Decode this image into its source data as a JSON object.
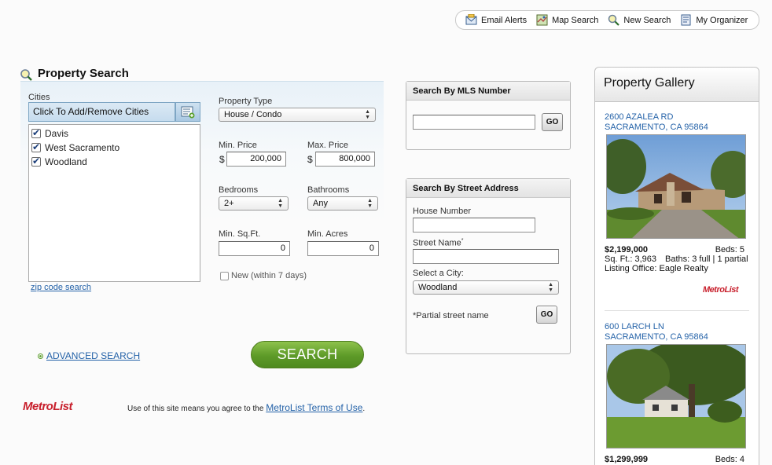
{
  "topnav": {
    "items": [
      {
        "label": "Email Alerts",
        "icon": "email-alerts-icon"
      },
      {
        "label": "Map Search",
        "icon": "map-icon"
      },
      {
        "label": "New Search",
        "icon": "search-icon"
      },
      {
        "label": "My Organizer",
        "icon": "organizer-icon"
      }
    ]
  },
  "property_search": {
    "title": "Property Search",
    "cities_label": "Cities",
    "cities_button": "Click To Add/Remove Cities",
    "cities": [
      {
        "name": "Davis",
        "checked": true
      },
      {
        "name": "West Sacramento",
        "checked": true
      },
      {
        "name": "Woodland",
        "checked": true
      }
    ],
    "zip_link": "zip code search",
    "property_type_label": "Property Type",
    "property_type_value": "House / Condo",
    "min_price_label": "Min. Price",
    "min_price_value": "200,000",
    "max_price_label": "Max. Price",
    "max_price_value": "800,000",
    "currency": "$",
    "bedrooms_label": "Bedrooms",
    "bedrooms_value": "2+",
    "bathrooms_label": "Bathrooms",
    "bathrooms_value": "Any",
    "min_sqft_label": "Min. Sq.Ft.",
    "min_sqft_value": "0",
    "min_acres_label": "Min. Acres",
    "min_acres_value": "0",
    "new_label": "New (within 7 days)",
    "new_checked": false,
    "advanced_link": "ADVANCED SEARCH",
    "search_button": "SEARCH"
  },
  "footer": {
    "logo": "MetroList",
    "terms_prefix": "Use of this site means you agree to the ",
    "terms_link": "MetroList Terms of Use",
    "terms_suffix": "."
  },
  "mls_search": {
    "title": "Search By MLS Number",
    "value": "",
    "go": "GO"
  },
  "street_search": {
    "title": "Search By Street Address",
    "house_number_label": "House Number",
    "street_name_label": "Street Name",
    "required_mark": "*",
    "city_label": "Select a City:",
    "city_value": "Woodland",
    "partial_note": "*Partial street name",
    "go": "GO"
  },
  "gallery": {
    "title": "Property Gallery",
    "listings": [
      {
        "address1": "2600 AZALEA RD",
        "address2": "SACRAMENTO, CA 95864",
        "price": "$2,199,000",
        "beds": "Beds: 5",
        "sqft": "Sq. Ft.: 3,963",
        "baths": "Baths: 3 full | 1 partial",
        "office": "Listing Office: Eagle Realty",
        "logo": "MetroList"
      },
      {
        "address1": "600 LARCH LN",
        "address2": "SACRAMENTO, CA 95864",
        "price": "$1,299,999",
        "beds": "Beds: 4"
      }
    ]
  },
  "colors": {
    "link": "#2462a8",
    "search_button": "#5d9a28",
    "logo_red": "#c8202d"
  }
}
